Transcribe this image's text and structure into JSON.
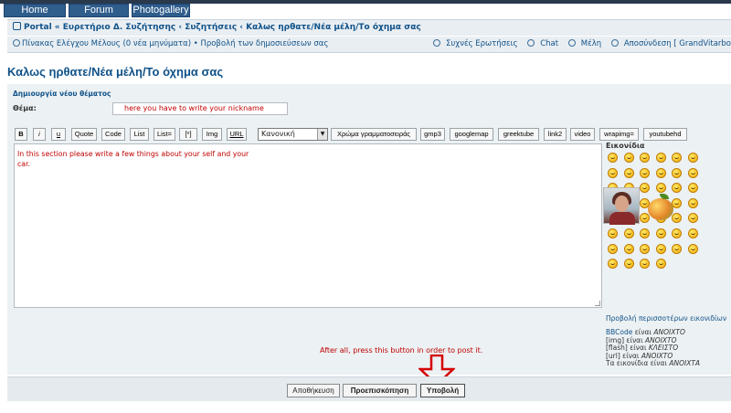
{
  "nav": {
    "home": "Home",
    "forum": "Forum",
    "gallery": "Photogallery"
  },
  "breadcrumb": "Portal « Ευρετήριο Δ. Συζήτησης ‹ Συζητήσεις ‹ Καλως ηρθατε/Νέα μέλη/Το όχημα σας",
  "userbar": {
    "left": "Πίνακας Ελέγχου Μέλους (0 νέα μηνύματα) • Προβολή των δημοσιεύσεων σας",
    "faq": "Συχνές Ερωτήσεις",
    "chat": "Chat",
    "members": "Μέλη",
    "logout": "Αποσύνδεση [ GrandVitarbo"
  },
  "page_title": "Καλως ηρθατε/Νέα μέλη/Το όχημα σας",
  "form": {
    "heading": "Δημιουργία νέου θέματος",
    "subject_label": "Θέμα:",
    "subject_value": "here you have to write your nickname",
    "message_text": "In this section please write a few things about your self and your car.",
    "font_size_selected": "Κανονική",
    "font_color_button": "Χρώμα γραμματοσειράς"
  },
  "toolbar": {
    "b": "B",
    "i": "i",
    "u": "u",
    "quote": "Quote",
    "code": "Code",
    "list": "List",
    "list_eq": "List=",
    "star": "[*]",
    "img": "Img",
    "url": "URL",
    "gmp3": "gmp3",
    "googlemap": "googlemap",
    "greektube": "greektube",
    "link2": "link2",
    "video": "video",
    "wrapimg": "wrapimg=",
    "youtubehd": "youtubehd"
  },
  "smilies": {
    "title": "Εικονίδια",
    "more": "Προβολή περισσοτέρων εικονιδίων",
    "count": 46
  },
  "bbinfo": {
    "l1a": "BBCode",
    "l1b": " είναι ",
    "l1c": "ΑΝΟΙΧΤΟ",
    "l2a": "[img] είναι ",
    "l2b": "ΑΝΟΙΧΤΟ",
    "l3a": "[flash] είναι ",
    "l3b": "ΚΛΕΙΣΤΟ",
    "l4a": "[url] είναι ",
    "l4b": "ΑΝΟΙΧΤΟ",
    "l5a": "Τα εικονίδια είναι ",
    "l5b": "ΑΝΟΙΧΤΑ"
  },
  "annotation": "After all, press this button in order to post it.",
  "buttons": {
    "save": "Αποθήκευση",
    "preview": "Προεπισκόπηση",
    "submit": "Υποβολή"
  },
  "colors": {
    "accent": "#105289",
    "hint": "#c00000",
    "nav": "#2f5d8c"
  }
}
